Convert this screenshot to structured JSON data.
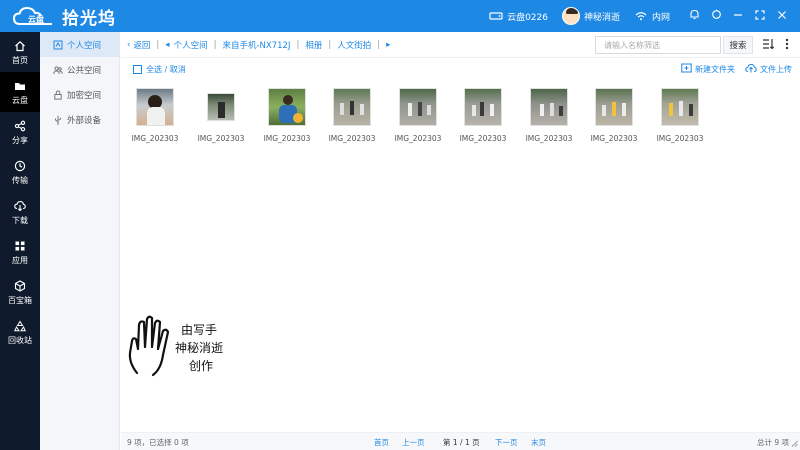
{
  "app": {
    "logo_badge": "云盘",
    "logo_text": "拾光坞",
    "device_name": "云盘0226",
    "username": "神秘消逝",
    "network": "内网"
  },
  "left_nav": [
    {
      "label": "首页",
      "icon": "home-icon"
    },
    {
      "label": "云盘",
      "icon": "folder-icon",
      "active": true
    },
    {
      "label": "分享",
      "icon": "share-icon"
    },
    {
      "label": "传输",
      "icon": "transfer-icon"
    },
    {
      "label": "下载",
      "icon": "download-icon"
    },
    {
      "label": "应用",
      "icon": "apps-icon"
    },
    {
      "label": "百宝箱",
      "icon": "toolbox-icon"
    },
    {
      "label": "回收站",
      "icon": "recycle-icon"
    }
  ],
  "sidebar": [
    {
      "label": "个人空间",
      "icon": "personal-space-icon",
      "active": true
    },
    {
      "label": "公共空间",
      "icon": "public-space-icon"
    },
    {
      "label": "加密空间",
      "icon": "lock-icon"
    },
    {
      "label": "外部设备",
      "icon": "usb-icon"
    }
  ],
  "breadcrumb": {
    "back": "返回",
    "items": [
      "个人空间",
      "来自手机-NX712J",
      "相册",
      "人文街拍"
    ]
  },
  "search": {
    "placeholder": "请输入名称筛选",
    "button": "搜索"
  },
  "toolbar": {
    "select_all": "全选 / 取消",
    "new_folder": "新建文件夹",
    "upload": "文件上传"
  },
  "files": [
    {
      "name": "IMG_202303"
    },
    {
      "name": "IMG_202303"
    },
    {
      "name": "IMG_202303"
    },
    {
      "name": "IMG_202303"
    },
    {
      "name": "IMG_202303"
    },
    {
      "name": "IMG_202303"
    },
    {
      "name": "IMG_202303"
    },
    {
      "name": "IMG_202303"
    },
    {
      "name": "IMG_202303"
    }
  ],
  "watermark": {
    "line1": "由写手",
    "line2": "神秘消逝",
    "line3": "创作"
  },
  "status": {
    "summary": "9 项，已选择 0 项",
    "first": "首页",
    "prev": "上一页",
    "page": "第 1 / 1 页",
    "next": "下一页",
    "last": "末页",
    "total": "总计 9 项"
  },
  "colors": {
    "accent": "#1e88e5",
    "nav_bg": "#0f1b2c"
  }
}
